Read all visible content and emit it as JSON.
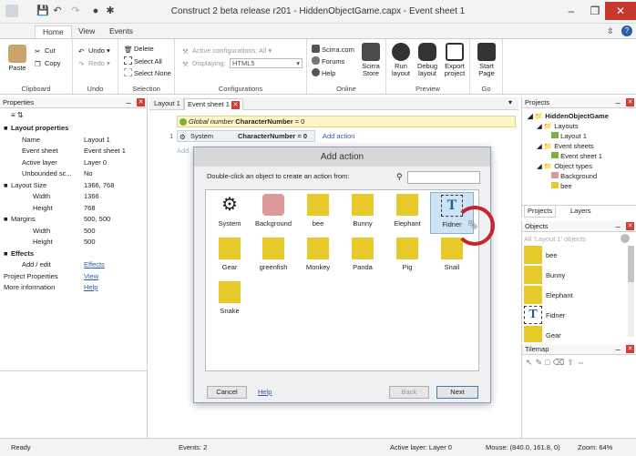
{
  "window": {
    "title": "Construct 2 beta release r201 - HiddenObjectGame.capx - Event sheet 1"
  },
  "ribbon_tabs": [
    "Home",
    "View",
    "Events"
  ],
  "ribbon": {
    "clipboard": {
      "paste": "Paste",
      "cut": "Cut",
      "copy": "Copy",
      "label": "Clipboard"
    },
    "undo": {
      "undo": "Undo",
      "redo": "Redo",
      "label": "Undo"
    },
    "selection": {
      "delete": "Delete",
      "select_all": "Select All",
      "select_none": "Select None",
      "label": "Selection"
    },
    "configurations": {
      "active": "Active configurations: All",
      "displaying": "Displaying:",
      "displaying_value": "HTML5",
      "label": "Configurations"
    },
    "online": {
      "scirra": "Scirra.com",
      "forums": "Forums",
      "help": "Help",
      "store": "Scirra Store",
      "label": "Online"
    },
    "preview": {
      "run": "Run layout",
      "debug": "Debug layout",
      "export": "Export project",
      "label": "Preview"
    },
    "go": {
      "start": "Start Page",
      "label": "Go"
    }
  },
  "properties_panel": {
    "title": "Properties",
    "sections": {
      "layout_properties": "Layout properties",
      "effects": "Effects"
    },
    "rows": [
      {
        "key": "Name",
        "value": "Layout 1"
      },
      {
        "key": "Event sheet",
        "value": "Event sheet 1"
      },
      {
        "key": "Active layer",
        "value": "Layer 0"
      },
      {
        "key": "Unbounded sc...",
        "value": "No"
      }
    ],
    "layout_size": {
      "key": "Layout Size",
      "value": "1366, 768",
      "width_key": "Width",
      "width": "1366",
      "height_key": "Height",
      "height": "768"
    },
    "margins": {
      "key": "Margins",
      "value": "500, 500",
      "width_key": "Width",
      "width": "500",
      "height_key": "Height",
      "height": "500"
    },
    "effects_add": {
      "key": "Add / edit",
      "value": "Effects"
    },
    "project_properties": {
      "key": "Project Properties",
      "value": "View"
    },
    "more_info": {
      "key": "More information",
      "value": "Help"
    }
  },
  "doc_tabs": [
    "Layout 1",
    "Event sheet 1"
  ],
  "event_sheet": {
    "global": "Global number",
    "global_name": "CharacterNumber",
    "global_value": "= 0",
    "event_number": "1",
    "condition_object": "System",
    "condition_text": "CharacterNumber = 0",
    "add_action": "Add action",
    "add_event": "Add"
  },
  "dialog": {
    "title": "Add action",
    "instruction": "Double-click an object to create an action from:",
    "search_value": "",
    "objects": [
      "System",
      "Background",
      "bee",
      "Bunny",
      "Elephant",
      "Fidner",
      "Gear",
      "greenfish",
      "Monkey",
      "Panda",
      "Pig",
      "Snail",
      "Snake"
    ],
    "cancel": "Cancel",
    "help": "Help",
    "back": "Back",
    "next": "Next"
  },
  "projects_panel": {
    "title": "Projects",
    "root": "HiddenObjectGame",
    "layouts": "Layouts",
    "layout1": "Layout 1",
    "event_sheets": "Event sheets",
    "event_sheet1": "Event sheet 1",
    "object_types": "Object types",
    "background": "Background",
    "bee": "bee",
    "tab_projects": "Projects",
    "tab_layers": "Layers"
  },
  "objects_panel": {
    "title": "Objects",
    "filter": "All 'Layout 1' objects",
    "items": [
      "bee",
      "Bunny",
      "Elephant",
      "Fidner",
      "Gear"
    ]
  },
  "tilemap_panel": {
    "title": "Tilemap"
  },
  "status_bar": {
    "ready": "Ready",
    "events": "Events: 2",
    "active_layer": "Active layer: Layer 0",
    "mouse": "Mouse: (840.0, 161.8, 0)",
    "zoom": "Zoom: 64%"
  },
  "colors": {
    "accent": "#2c5ea8",
    "close_red": "#d43b33",
    "object_yellow": "#e8c92a",
    "highlight_circle": "#c4262e"
  }
}
